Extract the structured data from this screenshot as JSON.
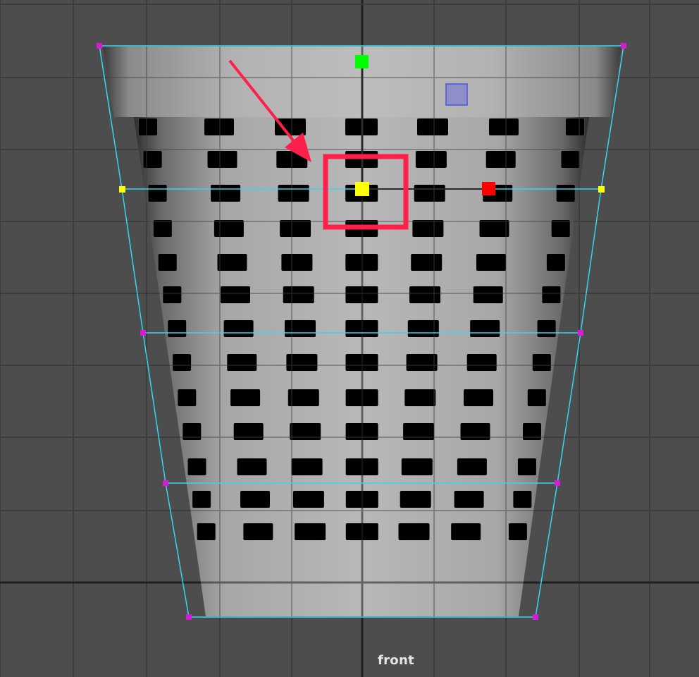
{
  "viewport": {
    "camera_label": "front",
    "background_color": "#4d4d4d",
    "grid_color": "#3b3b3b",
    "axis_color": "#1f1f1f"
  },
  "object": {
    "name_icon": "perforated-waste-basket-mesh",
    "body_color": "#a4a4a4",
    "hole_color": "#000000"
  },
  "lattice": {
    "line_color": "#35d6f0",
    "corner_point_color": "#d81ad8",
    "selected_row_point_color": "#ffff00"
  },
  "manipulator": {
    "y_handle_color": "#00ff00",
    "x_handle_color": "#ff0000",
    "center_handle_color": "#ffff00",
    "plane_handle_color": "#6c6cd6"
  },
  "annotation": {
    "highlight_color": "#ff1f4b",
    "arrow_color": "#ff1f4b"
  }
}
